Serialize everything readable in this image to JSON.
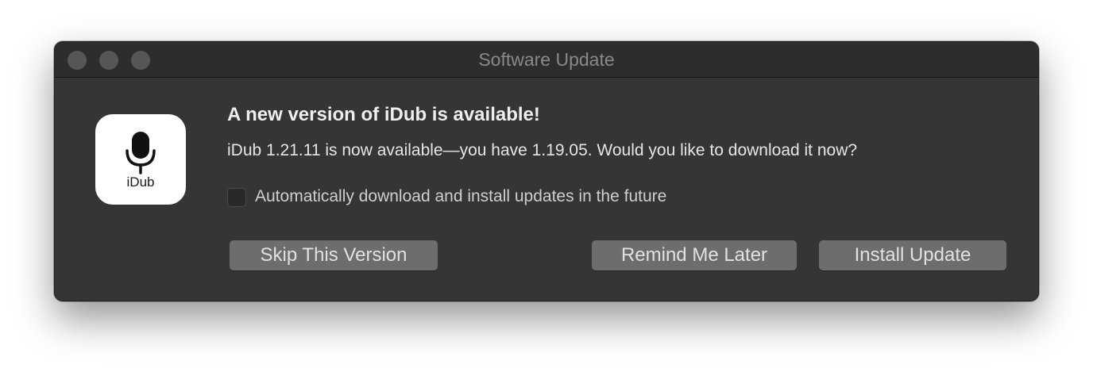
{
  "window": {
    "title": "Software Update"
  },
  "app": {
    "icon_name": "microphone-icon",
    "icon_label": "iDub"
  },
  "content": {
    "headline": "A new version of iDub is available!",
    "message": "iDub 1.21.11 is now available—you have 1.19.05. Would you like to download it now?",
    "auto_update_label": "Automatically download and install updates in the future",
    "auto_update_checked": false
  },
  "buttons": {
    "skip": "Skip This Version",
    "remind": "Remind Me Later",
    "install": "Install Update"
  },
  "colors": {
    "window_bg": "#373534",
    "titlebar_bg": "#2e2d2c",
    "button_bg": "#6e6d6c",
    "text_primary": "#f0efee"
  }
}
